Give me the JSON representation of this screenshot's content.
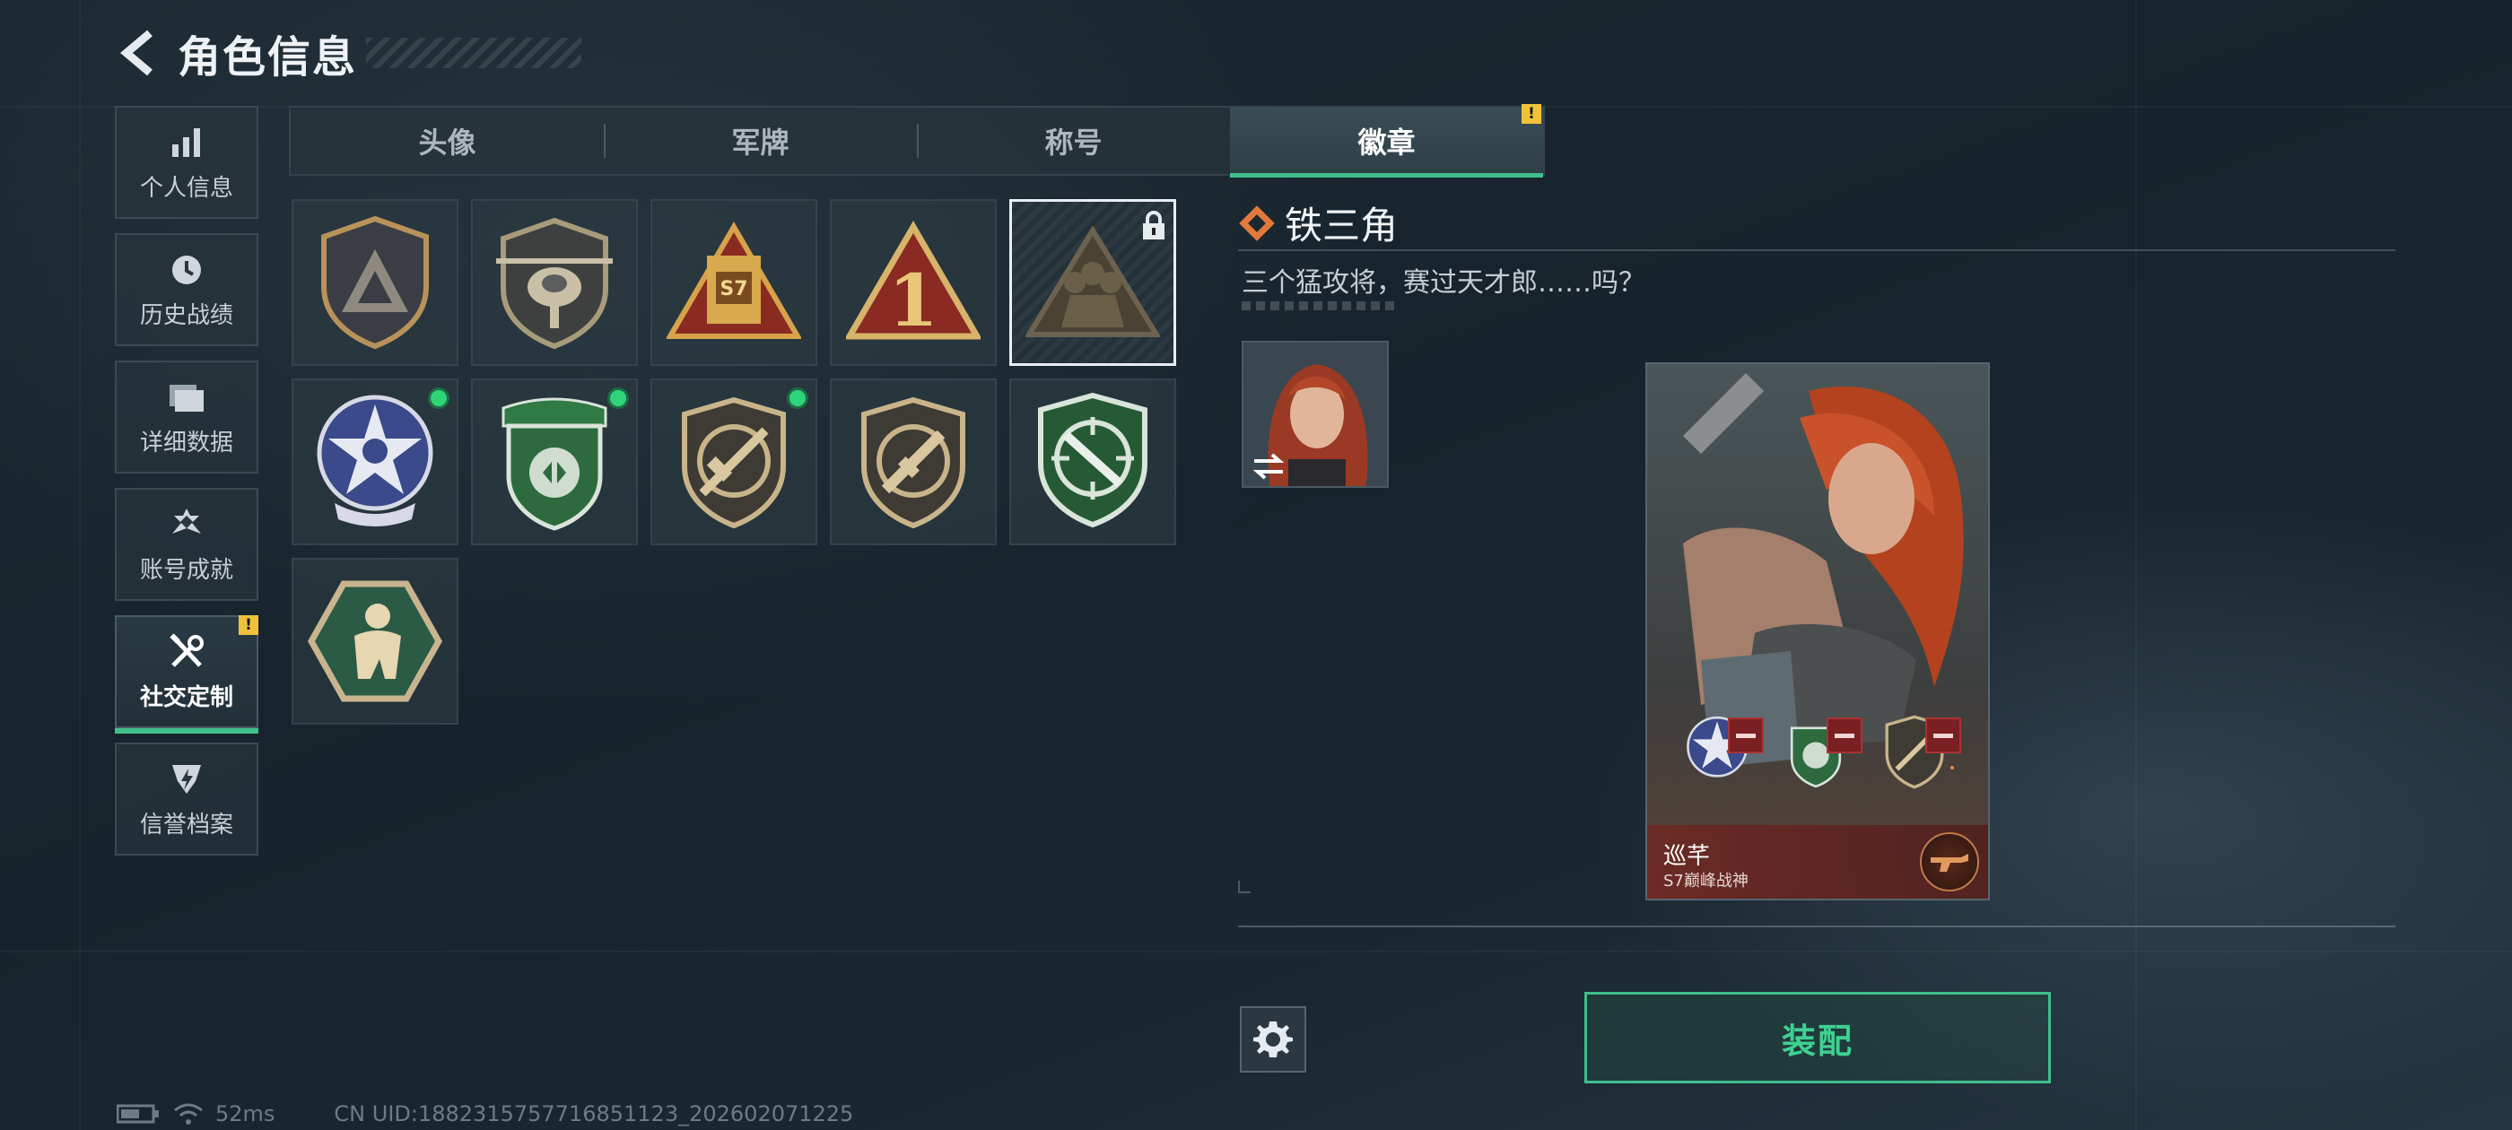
{
  "header": {
    "title": "角色信息"
  },
  "nav": {
    "items": [
      {
        "label": "个人信息",
        "icon": "bar-chart-icon"
      },
      {
        "label": "历史战绩",
        "icon": "clock-icon"
      },
      {
        "label": "详细数据",
        "icon": "folder-icon"
      },
      {
        "label": "账号成就",
        "icon": "achievement-icon"
      },
      {
        "label": "社交定制",
        "icon": "tools-icon",
        "active": true,
        "badge": "!"
      },
      {
        "label": "信誉档案",
        "icon": "shield-icon"
      }
    ]
  },
  "tabs": [
    {
      "label": "头像"
    },
    {
      "label": "军牌"
    },
    {
      "label": "称号"
    },
    {
      "label": "徽章",
      "active": true,
      "badge": "!"
    }
  ],
  "badges": [
    {
      "icon": "triangle-shield-badge-icon"
    },
    {
      "icon": "helicopter-badge-icon"
    },
    {
      "icon": "s7-badge-icon",
      "text": "S7"
    },
    {
      "icon": "number-one-badge-icon",
      "text": "1"
    },
    {
      "icon": "iron-triangle-badge-icon",
      "selected": true,
      "locked": true
    },
    {
      "icon": "star-skull-badge-icon",
      "equipped": true
    },
    {
      "icon": "green-emblem-badge-icon",
      "equipped": true
    },
    {
      "icon": "rifle-crossed-badge-icon",
      "equipped": true
    },
    {
      "icon": "smg-crossed-badge-icon"
    },
    {
      "icon": "knife-crosshair-badge-icon"
    },
    {
      "icon": "soldier-hexagon-badge-icon"
    }
  ],
  "detail": {
    "name": "铁三角",
    "description": "三个猛攻将，赛过天才郎……吗？"
  },
  "card": {
    "player_name": "巡芊",
    "player_title": "S7巅峰战神"
  },
  "actions": {
    "equip_label": "装配"
  },
  "status_bar": {
    "ping": "52ms",
    "uid": "CN UID:1882315757716851123_202602071225"
  },
  "colors": {
    "accent_green": "#3fbf8a",
    "badge_warning": "#f0c23a",
    "equipped_dot": "#2ed477",
    "remove_red": "#7a1f22"
  }
}
